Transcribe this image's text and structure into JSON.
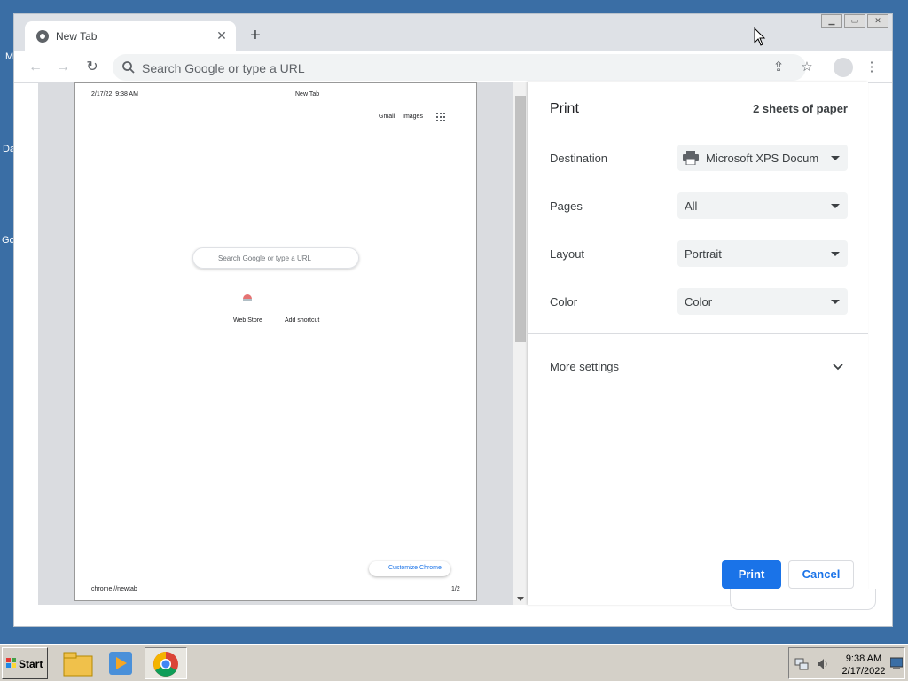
{
  "desktop": {
    "labels": [
      "M",
      "Da",
      "Go"
    ]
  },
  "browser": {
    "tab": {
      "title": "New Tab",
      "close": "✕"
    },
    "new_tab": "+",
    "window_controls": {
      "minimize": "▁",
      "restore": "▭",
      "close": "✕"
    },
    "toolbar": {
      "back": "←",
      "forward": "→",
      "reload": "↻",
      "omnibox_placeholder": "Search Google or type a URL",
      "share": "⇪",
      "bookmark": "☆",
      "menu": "⋮"
    }
  },
  "preview": {
    "header_date": "2/17/22, 9:38 AM",
    "header_title": "New Tab",
    "gmail": "Gmail",
    "images": "Images",
    "search_placeholder": "Search Google or type a URL",
    "shortcut_webstore": "Web Store",
    "shortcut_add": "Add shortcut",
    "customize": "Customize Chrome",
    "footer_url": "chrome://newtab",
    "footer_page": "1/2"
  },
  "print_panel": {
    "title": "Print",
    "sheets": "2 sheets of paper",
    "destination": {
      "label": "Destination",
      "value": "Microsoft XPS Docum"
    },
    "pages": {
      "label": "Pages",
      "value": "All"
    },
    "layout": {
      "label": "Layout",
      "value": "Portrait"
    },
    "color": {
      "label": "Color",
      "value": "Color"
    },
    "more_settings": "More settings",
    "print_button": "Print",
    "cancel_button": "Cancel"
  },
  "taskbar": {
    "start": "Start",
    "time": "9:38 AM",
    "date": "2/17/2022"
  },
  "colors": {
    "desktop": "#3a6ea5",
    "accent": "#1a73e8",
    "taskbar": "#d4d0c8"
  }
}
